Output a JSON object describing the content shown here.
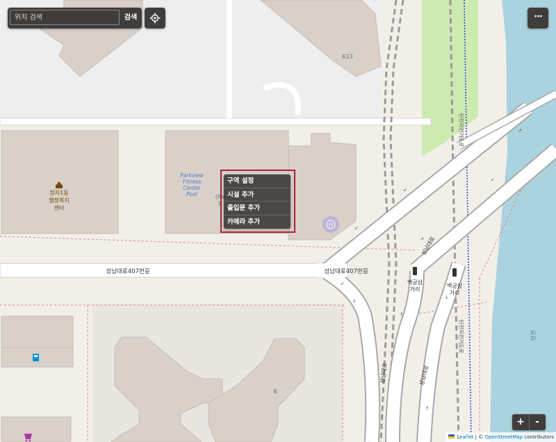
{
  "search": {
    "placeholder": "위치 검색",
    "button_label": "검색"
  },
  "more_button_label": "···",
  "context_menu": {
    "items": [
      {
        "label": "구역 설정"
      },
      {
        "label": "시설 추가"
      },
      {
        "label": "출입문 추가"
      },
      {
        "label": "카메라 추가"
      }
    ]
  },
  "zoom": {
    "in_label": "+",
    "out_label": "-"
  },
  "attribution": {
    "leaflet": "Leaflet",
    "separator": "|",
    "copyright": "©",
    "osm": "OpenStreetMap",
    "contributors": "contributors"
  },
  "map_labels": {
    "house_number_613": "613",
    "office_line1": "정자1동",
    "office_line2": "행정복지",
    "office_line3": "센터",
    "pool_line1": "Parkview",
    "pool_line2": "Fitness",
    "pool_line3": "Center",
    "pool_line4": "Pool",
    "partial_label_1": "(Pa",
    "partial_label_2": "T",
    "road_west": "성남대로407번길",
    "road_east": "성남대로407번길",
    "road_seongnam_upper": "성남대로",
    "road_seongnam_lower1": "성남대로",
    "road_seongnam_lower2": "성남대로",
    "bus_stop1_line1": "백궁삼",
    "bus_stop1_line2": "거리",
    "bus_stop2_line1": "백궁삼",
    "bus_stop2_line2": "거리",
    "bike_path_upper": "탄천자전거도로",
    "bike_path_lower": "탄천자전거도로",
    "river": "탄천",
    "building_b": "B"
  },
  "colors": {
    "land": "#f2efe9",
    "building": "#d9d0c9",
    "parking": "#eeeeee",
    "road": "#ffffff",
    "river": "#aad3df",
    "park": "#cdebb0",
    "boundary": "#a3203f",
    "controls": "#3f3d3b"
  },
  "icons": {
    "locate": "locate-icon",
    "townhall": "townhall-icon",
    "hospital": "hospital-icon",
    "fuel": "fuel-icon",
    "shop": "shop-icon",
    "bus_stop": "bus-stop-icon"
  }
}
